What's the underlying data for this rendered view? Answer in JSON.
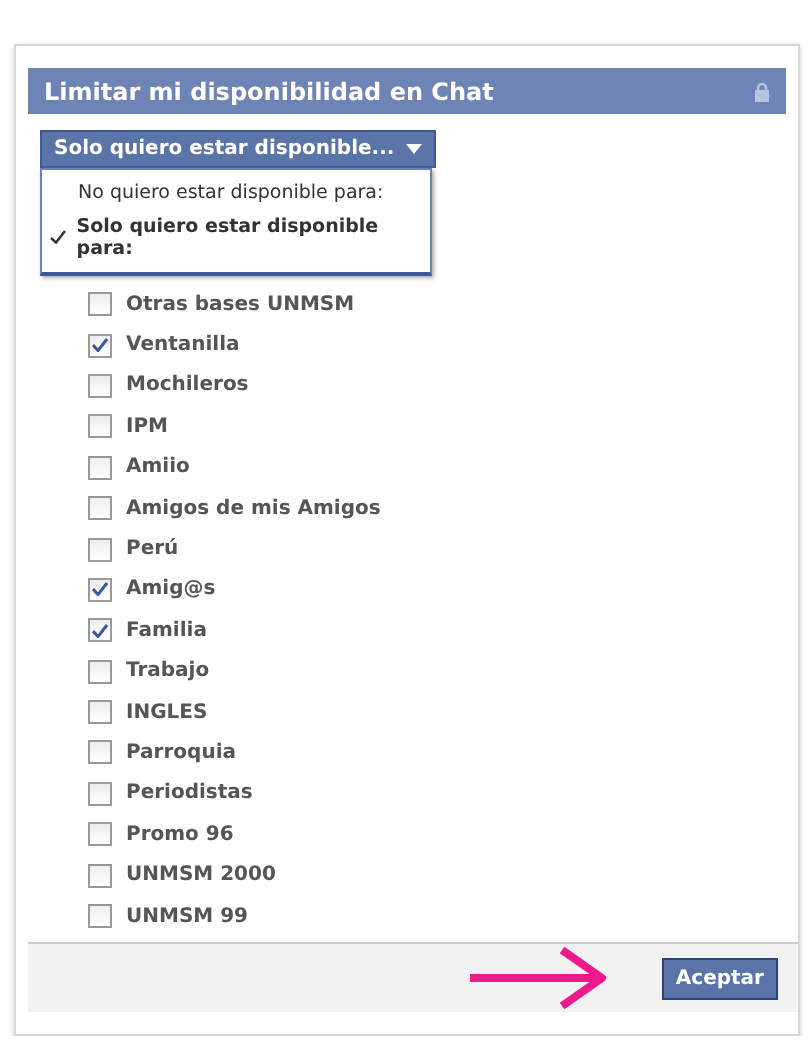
{
  "dialog": {
    "title": "Limitar mi disponibilidad en Chat",
    "locked": true
  },
  "dropdown": {
    "label": "Solo quiero estar disponible...",
    "expanded": true,
    "options": [
      {
        "label": "No quiero estar disponible para:",
        "selected": false
      },
      {
        "label": "Solo quiero estar disponible para:",
        "selected": true
      }
    ]
  },
  "lists": [
    {
      "label": "Otras bases UNMSM",
      "checked": false
    },
    {
      "label": "Ventanilla",
      "checked": true
    },
    {
      "label": "Mochileros",
      "checked": false
    },
    {
      "label": "IPM",
      "checked": false
    },
    {
      "label": "Amiio",
      "checked": false
    },
    {
      "label": "Amigos de mis Amigos",
      "checked": false
    },
    {
      "label": "Perú",
      "checked": false
    },
    {
      "label": "Amig@s",
      "checked": true
    },
    {
      "label": "Familia",
      "checked": true
    },
    {
      "label": "Trabajo",
      "checked": false
    },
    {
      "label": "INGLES",
      "checked": false
    },
    {
      "label": "Parroquia",
      "checked": false
    },
    {
      "label": "Periodistas",
      "checked": false
    },
    {
      "label": "Promo 96",
      "checked": false
    },
    {
      "label": "UNMSM 2000",
      "checked": false
    },
    {
      "label": "UNMSM 99",
      "checked": false
    }
  ],
  "footer": {
    "button": "Aceptar"
  }
}
